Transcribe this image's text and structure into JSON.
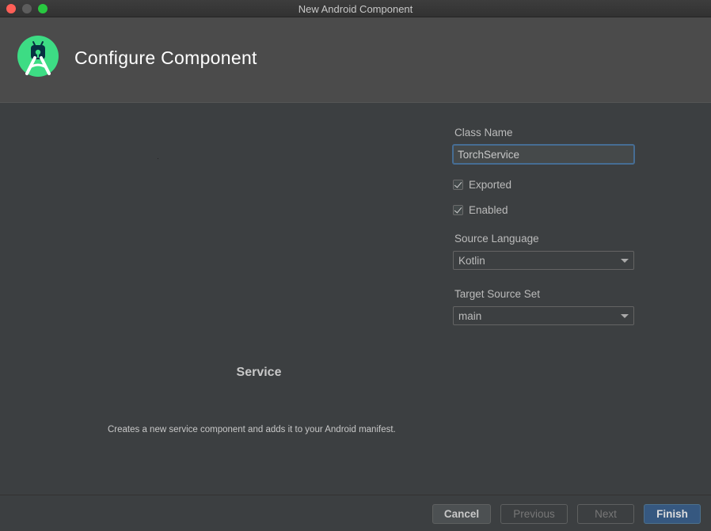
{
  "window": {
    "title": "New Android Component"
  },
  "header": {
    "title": "Configure Component",
    "logo_icon": "android-studio-icon",
    "brand_color": "#3ddc84"
  },
  "component": {
    "name": "Service",
    "description": "Creates a new service component and adds it to your Android manifest."
  },
  "form": {
    "class_name_label": "Class Name",
    "class_name_value": "TorchService",
    "exported": {
      "label": "Exported",
      "checked": true
    },
    "enabled": {
      "label": "Enabled",
      "checked": true
    },
    "source_language_label": "Source Language",
    "source_language_value": "Kotlin",
    "target_source_set_label": "Target Source Set",
    "target_source_set_value": "main"
  },
  "buttons": {
    "cancel": "Cancel",
    "previous": "Previous",
    "next": "Next",
    "finish": "Finish"
  },
  "colors": {
    "accent": "#365880",
    "focus_border": "#466d94",
    "background": "#3c3f41"
  }
}
